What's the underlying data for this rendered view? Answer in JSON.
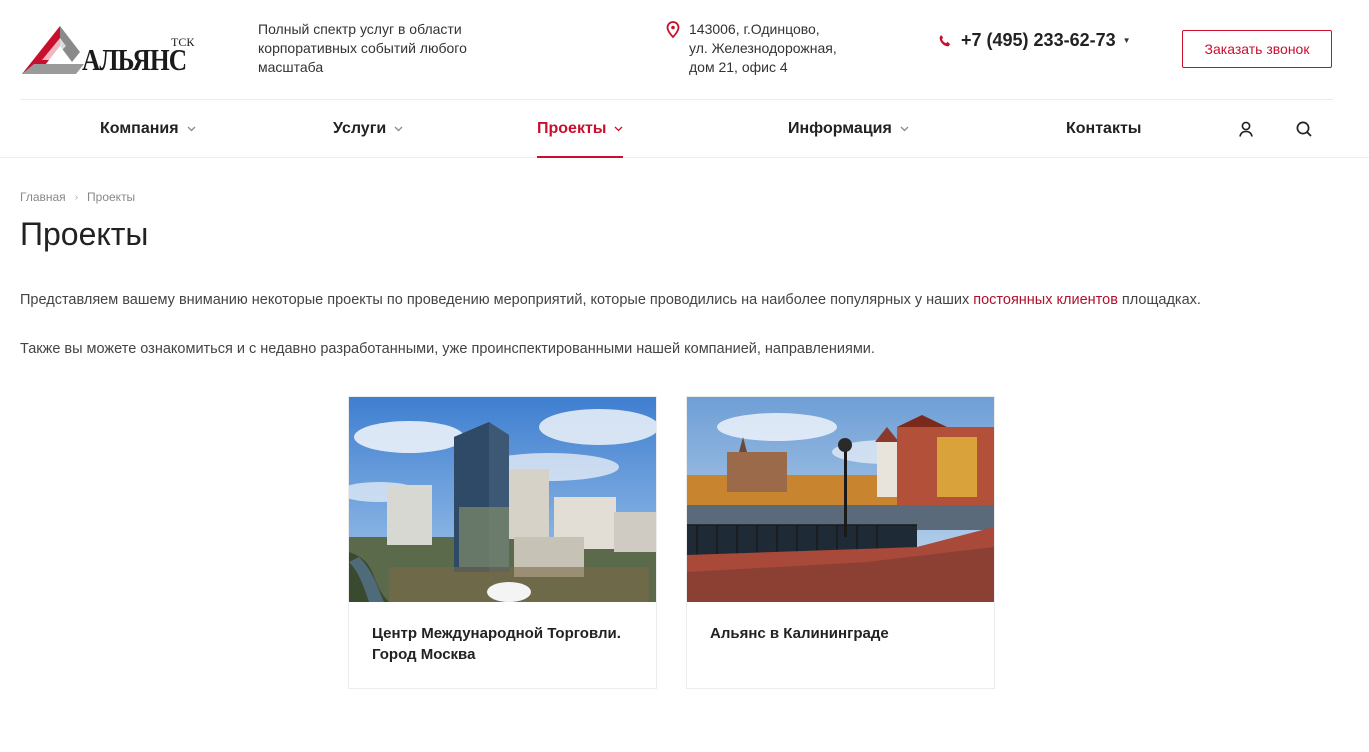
{
  "header": {
    "logo_text": "АЛЬЯНС",
    "logo_sub": "ТСК",
    "tagline": "Полный спектр услуг в области корпоративных событий любого масштаба",
    "address_lines": [
      "143006, г.Одинцово,",
      "ул. Железнодорожная,",
      "дом 21, офис 4"
    ],
    "phone": "+7 (495) 233-62-73",
    "callback_label": "Заказать звонок"
  },
  "nav": {
    "items": [
      {
        "label": "Компания",
        "dropdown": true
      },
      {
        "label": "Услуги",
        "dropdown": true
      },
      {
        "label": "Проекты",
        "dropdown": true,
        "active": true
      },
      {
        "label": "Информация",
        "dropdown": true
      },
      {
        "label": "Контакты",
        "dropdown": false
      }
    ],
    "icons": [
      "user-icon",
      "search-icon"
    ]
  },
  "breadcrumb": [
    "Главная",
    "Проекты"
  ],
  "page_title": "Проекты",
  "intro": {
    "before_link": "Представляем вашему вниманию некоторые проекты по проведению мероприятий, которые проводились на наиболее популярных у наших ",
    "link": "постоянных клиентов",
    "after_link": " площадках.",
    "second": "Также вы можете ознакомиться и с недавно разработанными, уже проинспектированными нашей компанией, направлениями."
  },
  "projects": [
    {
      "title_line1": "Центр Международной Торговли.",
      "title_line2": "Город Москва"
    },
    {
      "title_line1": "Альянс в Калининграде",
      "title_line2": ""
    }
  ],
  "colors": {
    "accent": "#c8102e",
    "text": "#222222",
    "muted": "#888888"
  }
}
